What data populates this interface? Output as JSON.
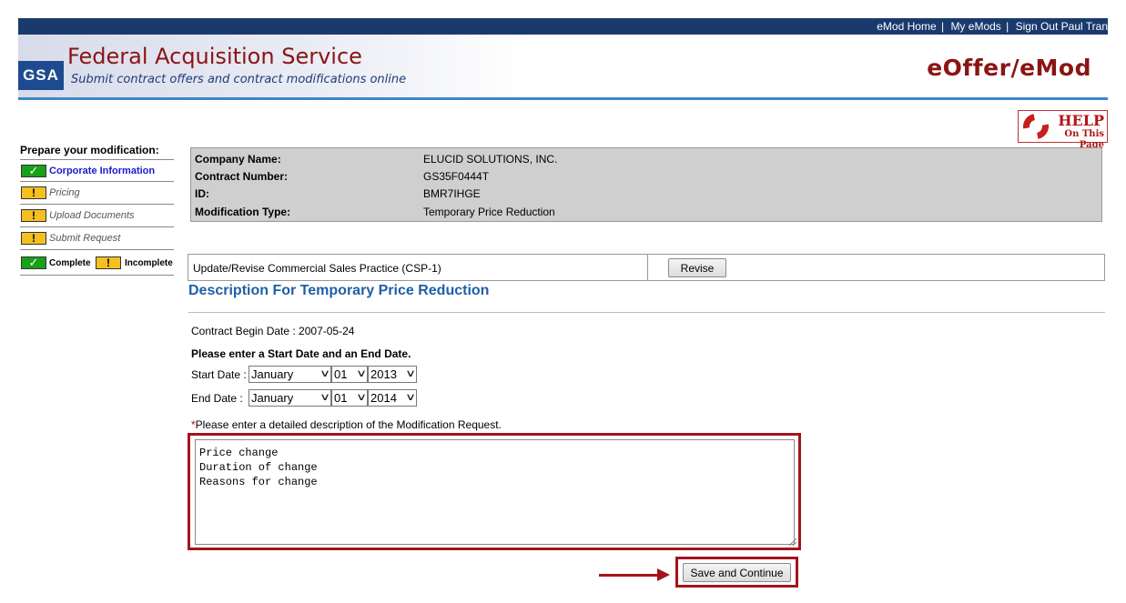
{
  "topnav": {
    "home": "eMod Home",
    "my_emods": "My eMods",
    "signout": "Sign Out Paul Tran",
    "separator": "|"
  },
  "header": {
    "logo": "GSA",
    "title": "Federal Acquisition Service",
    "subtitle": "Submit contract offers and contract modifications online",
    "app_name": "eOffer/eMod"
  },
  "help": {
    "line1": "HELP",
    "line2": "On This Page"
  },
  "sidebar": {
    "title": "Prepare your modification:",
    "items": [
      {
        "label": "Corporate Information",
        "status": "complete"
      },
      {
        "label": "Pricing",
        "status": "incomplete"
      },
      {
        "label": "Upload Documents",
        "status": "incomplete"
      },
      {
        "label": "Submit Request",
        "status": "incomplete"
      }
    ],
    "legend": {
      "complete": "Complete",
      "incomplete": "Incomplete"
    },
    "glyph_complete": "✓",
    "glyph_incomplete": "!"
  },
  "info": {
    "company_label": "Company Name:",
    "company_value": "ELUCID SOLUTIONS, INC.",
    "contract_label": "Contract Number:",
    "contract_value": "GS35F0444T",
    "id_label": "ID:",
    "id_value": "BMR7IHGE",
    "modtype_label": "Modification Type:",
    "modtype_value": "Temporary Price Reduction"
  },
  "csp": {
    "label": "Update/Revise Commercial Sales Practice (CSP-1)",
    "button": "Revise"
  },
  "description": {
    "title": "Description For Temporary Price Reduction",
    "contract_begin": "Contract Begin Date : 2007-05-24",
    "instruction": "Please enter a Start Date and an End Date.",
    "start_label": "Start Date :",
    "start_month": "January",
    "start_day": "01",
    "start_year": "2013",
    "end_label": "End Date  :",
    "end_month": "January",
    "end_day": "01",
    "end_year": "2014",
    "required_star": "*",
    "required_note": "Please enter a detailed description of the Modification Request.",
    "textarea_value": "Price change\nDuration of change\nReasons for change",
    "save_button": "Save and Continue"
  },
  "colors": {
    "nav_bar": "#1a3a6e",
    "brand_red": "#8b1414",
    "accent_blue": "#1f5fa6",
    "highlight_red": "#a4141d",
    "complete_green": "#18a018",
    "incomplete_yellow": "#f4c020"
  }
}
